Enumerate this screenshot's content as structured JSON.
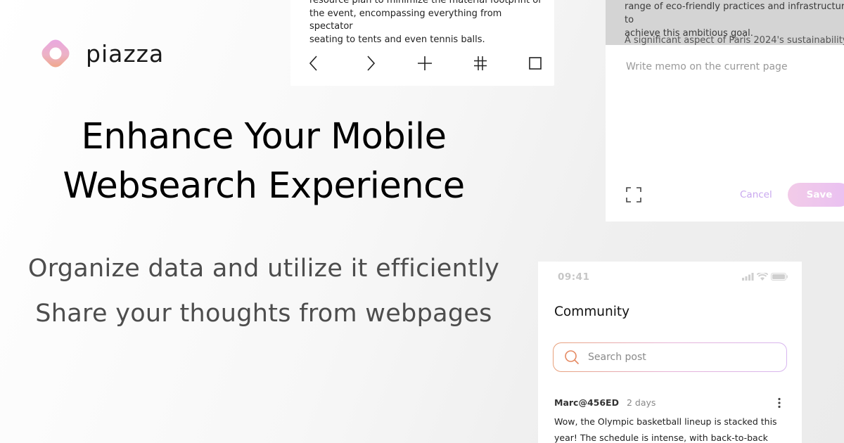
{
  "brand": {
    "name": "piazza"
  },
  "hero": {
    "headline_line1": "Enhance Your Mobile",
    "headline_line2": "Websearch Experience",
    "sub1": "Organize data and utilize it efficiently",
    "sub2": "Share your thoughts from webpages"
  },
  "reader": {
    "line0": "resource plan to minimize the material footprint of",
    "line1": "the event, encompassing everything from spectator",
    "line2": "seating to tents and even tennis balls.",
    "toolbar_icons": [
      "back-icon",
      "forward-icon",
      "add-icon",
      "hashtag-icon",
      "tabs-icon"
    ]
  },
  "memo": {
    "article_line1": "range of eco-friendly practices and infrastructure to",
    "article_line2": "achieve this ambitious goal.",
    "article_line3": "A significant aspect of Paris 2024's sustainability",
    "placeholder": "Write memo on the current page",
    "cancel_label": "Cancel",
    "save_label": "Save"
  },
  "community": {
    "status_time": "09:41",
    "title": "Community",
    "search_placeholder": "Search post",
    "post": {
      "author": "Marc@456ED",
      "time": "2 days",
      "body_line1": "Wow, the Olympic basketball lineup is stacked this",
      "body_line2": "year! The schedule is intense, with back-to-back"
    }
  },
  "colors": {
    "accent_orange": "#e8a07a",
    "accent_pink": "#e7b4d8",
    "accent_purple": "#c9a8ef"
  }
}
